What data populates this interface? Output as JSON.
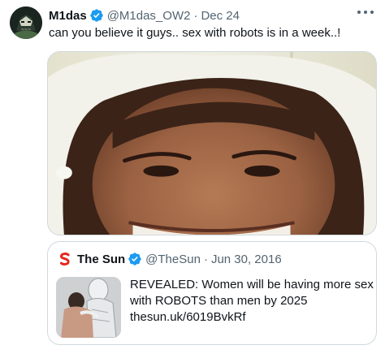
{
  "tweet": {
    "author_name": "M1das",
    "author_handle": "@M1das_OW2",
    "separator": "·",
    "date": "Dec 24",
    "text": "can you believe it guys.. sex with robots is in a week..!",
    "verified_color": "#1d9bf0",
    "avatar_icon": "masked-figure-avatar",
    "more_icon": "more-horizontal-icon",
    "media": {
      "description_icon": "selfie-video-thumbnail"
    }
  },
  "quoted_tweet": {
    "author_name": "The Sun",
    "author_handle": "@TheSun",
    "separator": "·",
    "date": "Jun 30, 2016",
    "logo_icon": "the-sun-logo-icon",
    "logo_color": "#e8251d",
    "text_lines": [
      "REVEALED: Women will be having more sex",
      "with ROBOTS than men by 2025",
      "thesun.uk/6019BvkRf"
    ]
  }
}
